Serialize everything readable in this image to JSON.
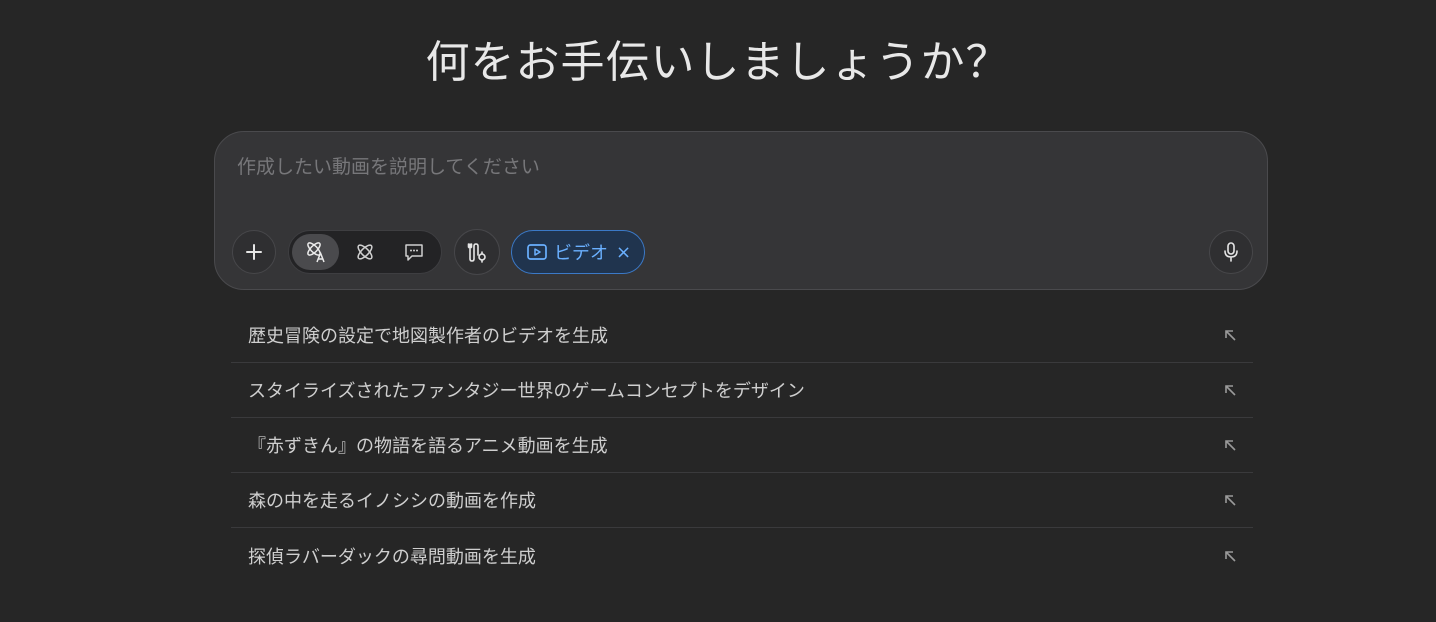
{
  "header": {
    "title": "何をお手伝いしましょうか？"
  },
  "composer": {
    "placeholder": "作成したい動画を説明してください",
    "value": "",
    "add_icon": "plus-icon",
    "modes": [
      {
        "icon": "atom-text-icon",
        "active": true
      },
      {
        "icon": "atom-icon",
        "active": false
      },
      {
        "icon": "chat-bubble-icon",
        "active": false
      }
    ],
    "tools_icon": "tools-icon",
    "chip": {
      "icon": "play-video-icon",
      "label": "ビデオ",
      "close": "×"
    },
    "mic_icon": "microphone-icon"
  },
  "suggestions": [
    {
      "text": "歴史冒険の設定で地図製作者のビデオを生成"
    },
    {
      "text": "スタイライズされたファンタジー世界のゲームコンセプトをデザイン"
    },
    {
      "text": "『赤ずきん』の物語を語るアニメ動画を生成"
    },
    {
      "text": "森の中を走るイノシシの動画を作成"
    },
    {
      "text": "探偵ラバーダックの尋問動画を生成"
    }
  ],
  "colors": {
    "background": "#262626",
    "composer": "#353537",
    "accent": "#6ab0ff",
    "chip_bg": "#20344e",
    "chip_border": "#3b79c7"
  }
}
